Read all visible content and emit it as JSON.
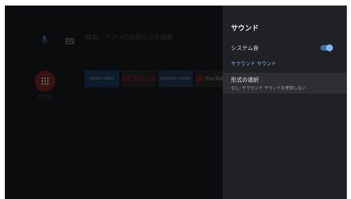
{
  "launcher": {
    "search_placeholder": "検索、アプリに話題などを検索",
    "apps_label": "アプリ",
    "tiles": [
      {
        "name": "prime-video",
        "text": "prime video"
      },
      {
        "name": "netflix",
        "text": "NETFLIX"
      },
      {
        "name": "amazon-music",
        "text": "amazon music"
      },
      {
        "name": "youtube",
        "text": "YouTube"
      }
    ],
    "icons": [
      "mic-icon",
      "keyboard-icon",
      "apps-grid-icon"
    ]
  },
  "panel": {
    "title": "サウンド",
    "system_sound": {
      "label": "システム音",
      "enabled": true
    },
    "section": "サラウンド サウンド",
    "format": {
      "label": "形式の選択",
      "value": "なし: サラウンド サウンドを使用しない"
    }
  },
  "colors": {
    "accent": "#8ab4f8",
    "panel_bg": "#202124",
    "selected_row_bg": "#2e2f32",
    "apps_button": "#d93025"
  }
}
